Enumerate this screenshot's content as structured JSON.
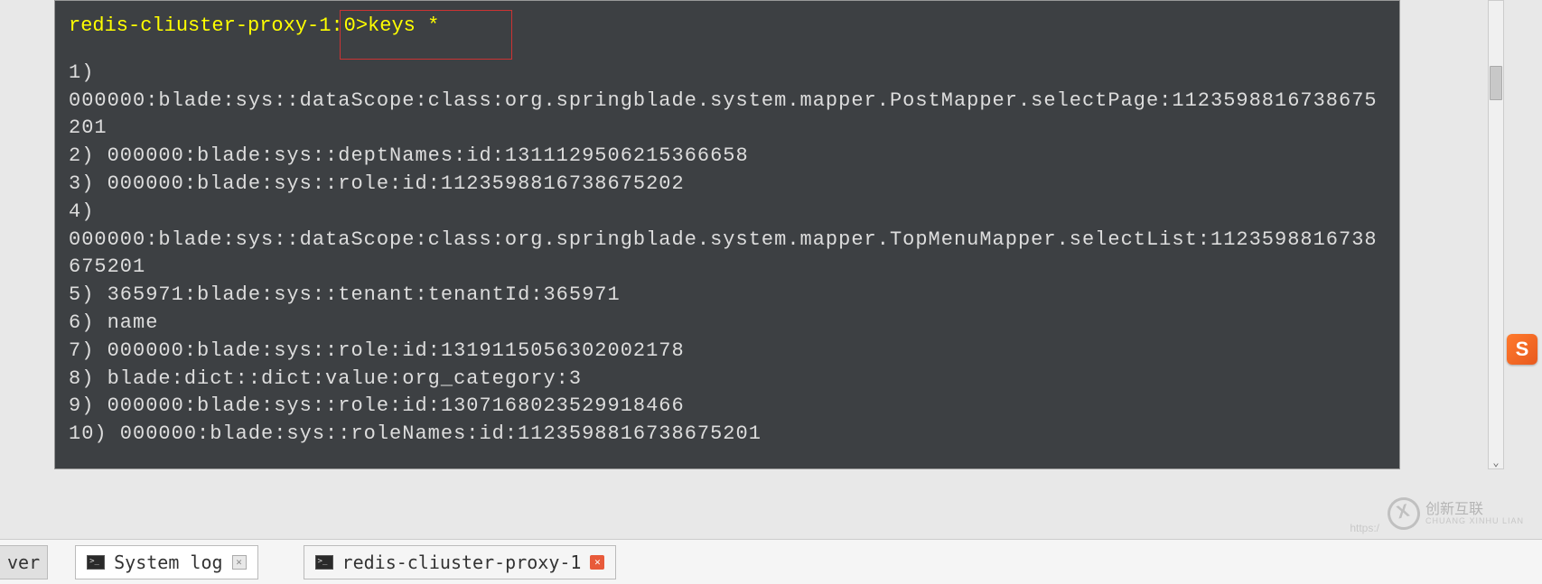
{
  "terminal": {
    "prompt": "redis-cliuster-proxy-1:",
    "command": "0>keys *",
    "output_lines": [
      "1)",
      "000000:blade:sys::dataScope:class:org.springblade.system.mapper.PostMapper.selectPage:1123598816738675201",
      "2) 000000:blade:sys::deptNames:id:1311129506215366658",
      "3) 000000:blade:sys::role:id:1123598816738675202",
      "4)",
      "000000:blade:sys::dataScope:class:org.springblade.system.mapper.TopMenuMapper.selectList:1123598816738675201",
      "5) 365971:blade:sys::tenant:tenantId:365971",
      "6) name",
      "7) 000000:blade:sys::role:id:1319115056302002178",
      "8) blade:dict::dict:value:org_category:3",
      "9) 000000:blade:sys::role:id:1307168023529918466",
      "10) 000000:blade:sys::roleNames:id:1123598816738675201"
    ]
  },
  "tabs": {
    "partial_tab": "ver",
    "tab1_label": "System log",
    "tab2_label": "redis-cliuster-proxy-1"
  },
  "watermark": {
    "main": "创新互联",
    "sub": "CHUANG XINHU LIAN"
  },
  "https_text": "https:/",
  "sogou_letter": "S"
}
